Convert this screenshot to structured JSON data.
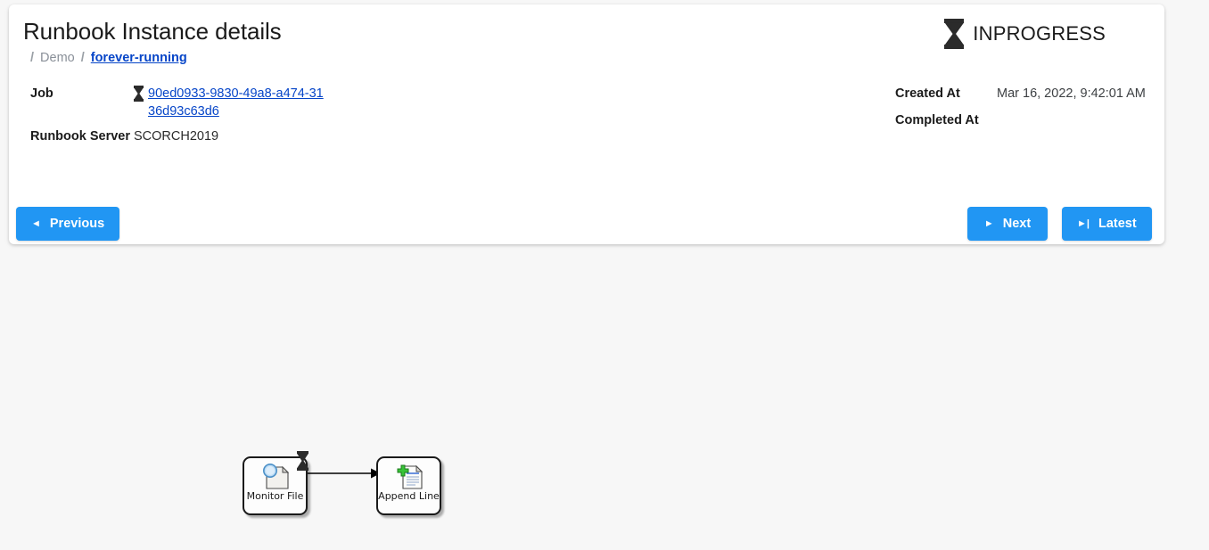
{
  "page": {
    "background_color": "#f7f7f7",
    "accent_color": "#2196f3",
    "link_color": "#0645c8"
  },
  "header": {
    "title": "Runbook Instance details",
    "breadcrumb": {
      "sep1": "/",
      "folder": "Demo",
      "sep2": "/",
      "current": "forever-running"
    },
    "status": {
      "icon": "hourglass-icon",
      "label": "INPROGRESS"
    }
  },
  "details": {
    "left": {
      "job_label": "Job",
      "job_icon": "hourglass-icon",
      "job_id": "90ed0933-9830-49a8-a474-3136d93c63d6",
      "runbook_server_label": "Runbook Server",
      "runbook_server_value": "SCORCH2019"
    },
    "right": {
      "created_at_label": "Created At",
      "created_at_value": "Mar 16, 2022, 9:42:01 AM",
      "completed_at_label": "Completed At",
      "completed_at_value": ""
    }
  },
  "toolbar": {
    "previous_label": "Previous",
    "previous_glyph": "◄",
    "next_label": "Next",
    "next_glyph": "►",
    "latest_label": "Latest",
    "latest_glyph": "►|"
  },
  "diagram": {
    "nodes": [
      {
        "id": "monitor-file",
        "label": "Monitor File",
        "icon": "monitor-file-icon",
        "status_icon": "hourglass-icon"
      },
      {
        "id": "append-line",
        "label": "Append Line",
        "icon": "append-line-icon"
      }
    ],
    "link": {
      "from": "monitor-file",
      "to": "append-line",
      "arrow": "arrow-right"
    }
  }
}
